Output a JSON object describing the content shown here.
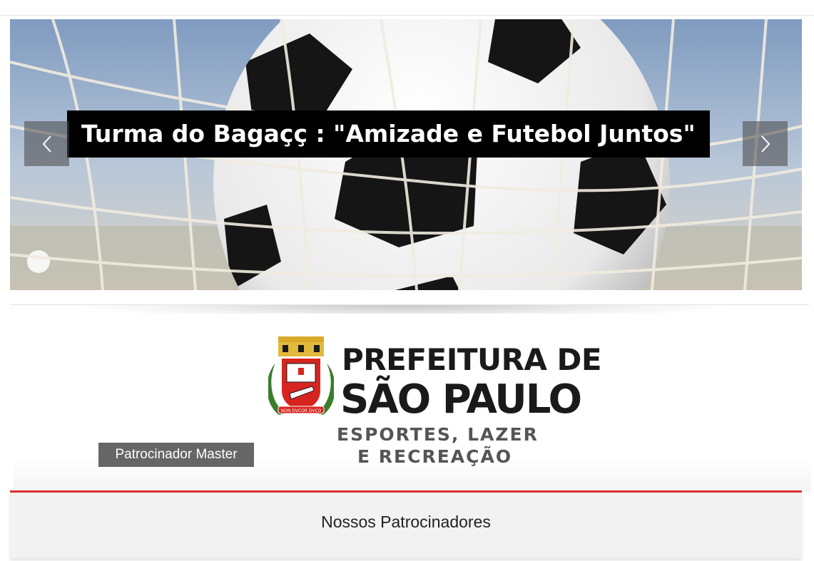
{
  "slider": {
    "caption": "Turma do Bagaçç : \"Amizade e Futebol Juntos\"",
    "prev_icon": "chevron-left-icon",
    "next_icon": "chevron-right-icon"
  },
  "sponsor": {
    "logo": {
      "line1": "PREFEITURA DE",
      "line2": "SÃO PAULO",
      "line3": "ESPORTES, LAZER",
      "line4": "E RECREAÇÃO",
      "crest_motto": "NON DVCOR DVCO"
    },
    "badge": "Patrocinador Master"
  },
  "partners": {
    "title": "Nossos Patrocinadores"
  },
  "colors": {
    "accent_red": "#d9302c",
    "badge_gray": "#666666",
    "caption_bg": "#000000"
  }
}
